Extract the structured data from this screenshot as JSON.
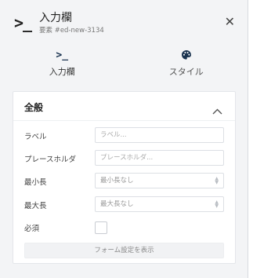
{
  "header": {
    "icon": "terminal-prompt-icon",
    "title": "入力欄",
    "subtitle": "要素 #ed-new-3134",
    "close_icon": "close-icon"
  },
  "tabs": [
    {
      "label": "入力欄",
      "icon": "terminal-prompt-icon",
      "active": true
    },
    {
      "label": "スタイル",
      "icon": "palette-icon",
      "active": false
    }
  ],
  "section": {
    "title": "全般",
    "collapse_icon": "chevron-up-icon"
  },
  "fields": {
    "label": {
      "label": "ラベル",
      "placeholder": "ラベル..."
    },
    "placeholder": {
      "label": "プレースホルダ",
      "placeholder": "プレースホルダ..."
    },
    "min_length": {
      "label": "最小長",
      "placeholder": "最小長なし"
    },
    "max_length": {
      "label": "最大長",
      "placeholder": "最大長なし"
    },
    "required": {
      "label": "必須",
      "checked": false
    }
  },
  "form_settings_button": "フォーム設定を表示",
  "colors": {
    "panel_bg": "#f3f4f6",
    "card_bg": "#ffffff",
    "accent_icon": "#1a3350"
  }
}
